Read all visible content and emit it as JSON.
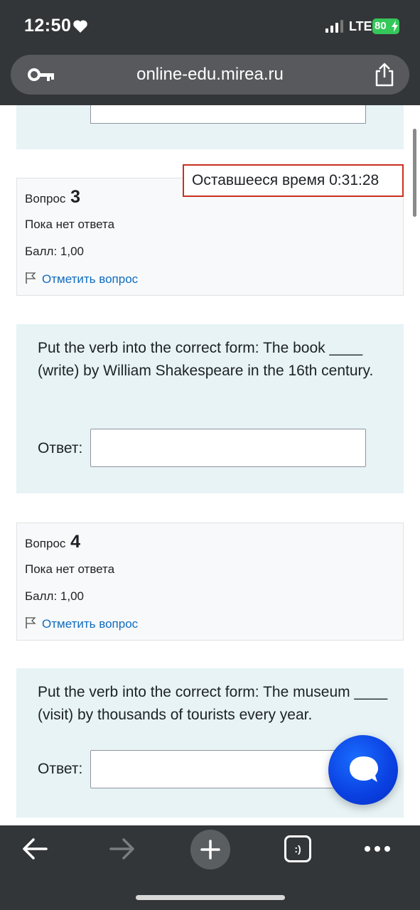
{
  "status_bar": {
    "time": "12:50",
    "network": "LTE",
    "battery": "80"
  },
  "browser": {
    "url": "online-edu.mirea.ru"
  },
  "timer": {
    "text": "Оставшееся время 0:31:28"
  },
  "questions": [
    {
      "label": "Вопрос",
      "number": "3",
      "state": "Пока нет ответа",
      "grade": "Балл: 1,00",
      "flag_label": "Отметить вопрос",
      "text": "Put the verb into the correct form: The book ____ (write) by William Shakespeare in the 16th century.",
      "answer_label": "Ответ:",
      "answer_value": ""
    },
    {
      "label": "Вопрос",
      "number": "4",
      "state": "Пока нет ответа",
      "grade": "Балл: 1,00",
      "flag_label": "Отметить вопрос",
      "text": "Put the verb into the correct form: The museum ____ (visit) by thousands of tourists every year.",
      "answer_label": "Ответ:",
      "answer_value": ""
    }
  ],
  "toolbar": {
    "tabs_glyph": ":)"
  },
  "colors": {
    "accent_link": "#0f6cbf",
    "timer_border": "#ca3120",
    "question_bg": "#e7f3f5",
    "chat_button": "#0a3fe0"
  }
}
